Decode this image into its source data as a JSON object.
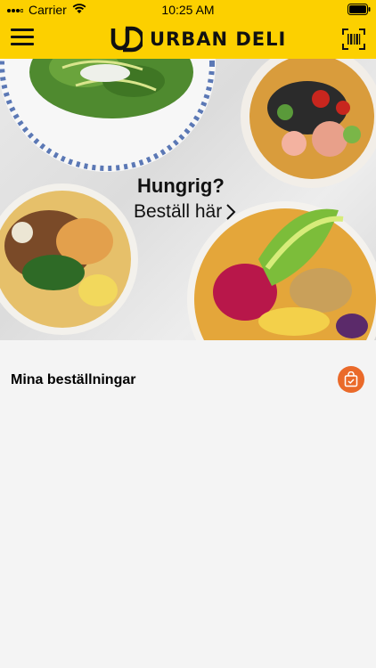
{
  "status_bar": {
    "carrier": "Carrier",
    "time": "10:25 AM"
  },
  "header": {
    "logo_text": "URBAN DELI",
    "icons": [
      "menu-icon",
      "barcode-scanner-icon"
    ]
  },
  "hero": {
    "title": "Hungrig?",
    "cta": "Beställ här"
  },
  "orders": {
    "title": "Mina beställningar",
    "icon": "shopping-bag-check-icon"
  },
  "colors": {
    "brand_yellow": "#fcd000",
    "accent_orange": "#ea6a2a",
    "background": "#f4f4f4"
  }
}
